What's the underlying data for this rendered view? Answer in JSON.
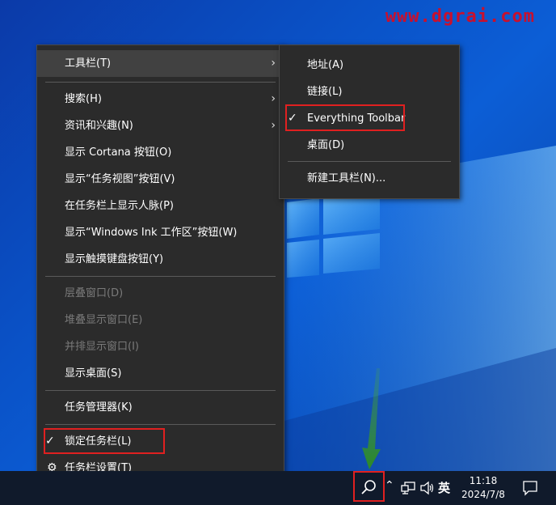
{
  "watermark": "www.dgrai.com",
  "context_menu": {
    "items": [
      {
        "label": "工具栏(T)"
      },
      {
        "label": "搜索(H)"
      },
      {
        "label": "资讯和兴趣(N)"
      },
      {
        "label": "显示 Cortana 按钮(O)"
      },
      {
        "label": "显示“任务视图”按钮(V)"
      },
      {
        "label": "在任务栏上显示人脉(P)"
      },
      {
        "label": "显示“Windows Ink 工作区”按钮(W)"
      },
      {
        "label": "显示触摸键盘按钮(Y)"
      },
      {
        "label": "层叠窗口(D)"
      },
      {
        "label": "堆叠显示窗口(E)"
      },
      {
        "label": "并排显示窗口(I)"
      },
      {
        "label": "显示桌面(S)"
      },
      {
        "label": "任务管理器(K)"
      },
      {
        "label": "锁定任务栏(L)",
        "checked": true
      },
      {
        "label": "任务栏设置(T)"
      }
    ]
  },
  "toolbar_submenu": {
    "items": [
      {
        "label": "地址(A)"
      },
      {
        "label": "链接(L)"
      },
      {
        "label": "Everything Toolbar",
        "checked": true
      },
      {
        "label": "桌面(D)"
      },
      {
        "label": "新建工具栏(N)..."
      }
    ]
  },
  "taskbar": {
    "ime": "英",
    "time": "11:18",
    "date": "2024/7/8"
  },
  "colors": {
    "menu_bg": "#2b2b2b",
    "highlight_box": "#e02020",
    "arrow": "#3a8a2e",
    "watermark": "#c8102e"
  }
}
